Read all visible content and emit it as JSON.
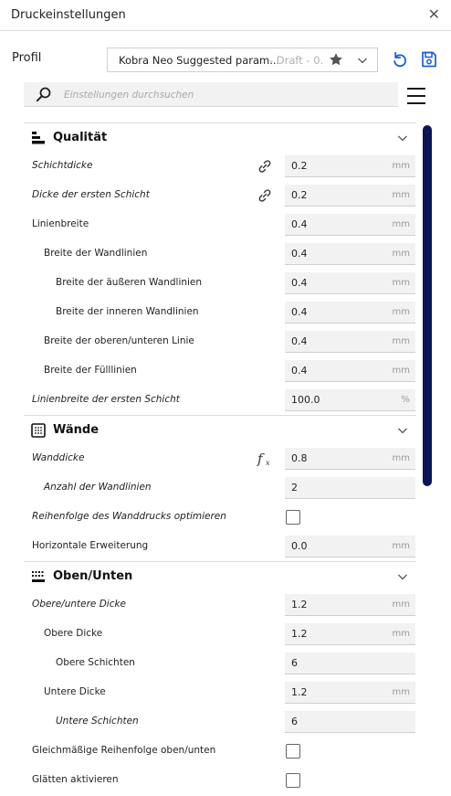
{
  "window": {
    "title": "Druckeinstellungen",
    "close_glyph": "✕"
  },
  "profile": {
    "label": "Profil",
    "name": "Kobra Neo Suggested param...",
    "draft": "- Draft - 0...",
    "icons": {
      "favorite": "star-icon",
      "dropdown": "chevron-down-icon",
      "reset": "undo-icon",
      "save": "save-icon"
    }
  },
  "search": {
    "placeholder": "Einstellungen durchsuchen"
  },
  "menu": {
    "icon": "hamburger-menu-icon"
  },
  "colors": {
    "accent": "#1e5bd6",
    "scrollbar": "#0c1555",
    "field_bg": "#f2f2f2"
  },
  "categories": [
    {
      "title": "Qualität",
      "icon": "quality-icon",
      "settings": [
        {
          "label": "Schichtdicke",
          "value": "0.2",
          "unit": "mm",
          "indent": 0,
          "italic": true,
          "icon": "link-icon"
        },
        {
          "label": "Dicke der ersten Schicht",
          "value": "0.2",
          "unit": "mm",
          "indent": 0,
          "italic": true,
          "icon": "link-icon"
        },
        {
          "label": "Linienbreite",
          "value": "0.4",
          "unit": "mm",
          "indent": 0,
          "italic": false
        },
        {
          "label": "Breite der Wandlinien",
          "value": "0.4",
          "unit": "mm",
          "indent": 1,
          "italic": false
        },
        {
          "label": "Breite der äußeren Wandlinien",
          "value": "0.4",
          "unit": "mm",
          "indent": 2,
          "italic": false
        },
        {
          "label": "Breite der inneren Wandlinien",
          "value": "0.4",
          "unit": "mm",
          "indent": 2,
          "italic": false
        },
        {
          "label": "Breite der oberen/unteren Linie",
          "value": "0.4",
          "unit": "mm",
          "indent": 1,
          "italic": false
        },
        {
          "label": "Breite der Fülllinien",
          "value": "0.4",
          "unit": "mm",
          "indent": 1,
          "italic": false
        },
        {
          "label": "Linienbreite der ersten Schicht",
          "value": "100.0",
          "unit": "%",
          "indent": 0,
          "italic": true
        }
      ]
    },
    {
      "title": "Wände",
      "icon": "walls-icon",
      "settings": [
        {
          "label": "Wanddicke",
          "value": "0.8",
          "unit": "mm",
          "indent": 0,
          "italic": true,
          "icon": "function-icon"
        },
        {
          "label": "Anzahl der Wandlinien",
          "value": "2",
          "unit": "",
          "indent": 1,
          "italic": true
        },
        {
          "label": "Reihenfolge des Wanddrucks optimieren",
          "type": "checkbox",
          "checked": false,
          "indent": 0,
          "italic": true
        },
        {
          "label": "Horizontale Erweiterung",
          "value": "0.0",
          "unit": "mm",
          "indent": 0,
          "italic": false
        }
      ]
    },
    {
      "title": "Oben/Unten",
      "icon": "top-bottom-icon",
      "settings": [
        {
          "label": "Obere/untere Dicke",
          "value": "1.2",
          "unit": "mm",
          "indent": 0,
          "italic": true
        },
        {
          "label": "Obere Dicke",
          "value": "1.2",
          "unit": "mm",
          "indent": 1,
          "italic": false
        },
        {
          "label": "Obere Schichten",
          "value": "6",
          "unit": "",
          "indent": 2,
          "italic": false
        },
        {
          "label": "Untere Dicke",
          "value": "1.2",
          "unit": "mm",
          "indent": 1,
          "italic": false
        },
        {
          "label": "Untere Schichten",
          "value": "6",
          "unit": "",
          "indent": 2,
          "italic": true
        },
        {
          "label": "Gleichmäßige Reihenfolge oben/unten",
          "type": "checkbox",
          "checked": false,
          "indent": 0,
          "italic": false
        },
        {
          "label": "Glätten aktivieren",
          "type": "checkbox",
          "checked": false,
          "indent": 0,
          "italic": false
        }
      ]
    }
  ]
}
